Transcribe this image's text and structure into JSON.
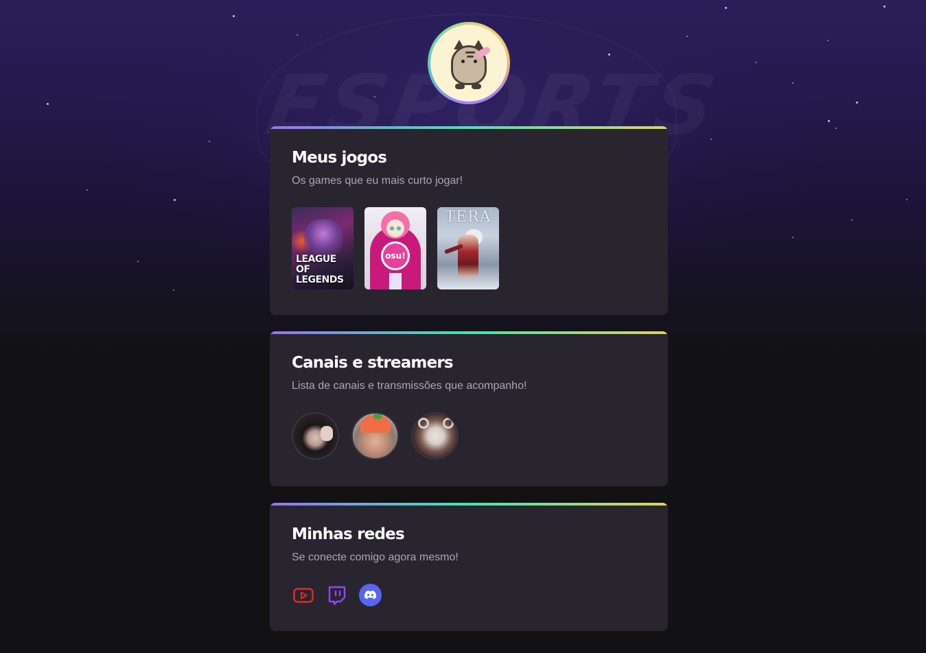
{
  "profile": {
    "avatar_icon": "pusheen-cat-avatar"
  },
  "sections": {
    "games": {
      "title": "Meus jogos",
      "subtitle": "Os games que eu mais curto jogar!",
      "items": [
        {
          "name": "League of Legends",
          "cover_text": "LEAGUE OF LEGENDS"
        },
        {
          "name": "osu!",
          "cover_text": "osu!"
        },
        {
          "name": "TERA",
          "cover_text": "TERA"
        }
      ]
    },
    "streamers": {
      "title": "Canais e streamers",
      "subtitle": "Lista de canais e transmissões que acompanho!",
      "items": [
        {
          "icon": "streamer-avatar-1"
        },
        {
          "icon": "streamer-avatar-2"
        },
        {
          "icon": "streamer-avatar-3"
        }
      ]
    },
    "socials": {
      "title": "Minhas redes",
      "subtitle": "Se conecte comigo agora mesmo!",
      "items": [
        {
          "icon": "youtube-icon",
          "color": "#e02a2a"
        },
        {
          "icon": "twitch-icon",
          "color": "#9146ff"
        },
        {
          "icon": "discord-icon",
          "color": "#5865f2"
        }
      ]
    }
  },
  "colors": {
    "background": "#121214",
    "card": "#29252f",
    "accent_gradient": [
      "#9572fc",
      "#43e7ad",
      "#e2d45c"
    ],
    "subtitle": "#a8a8b3"
  }
}
